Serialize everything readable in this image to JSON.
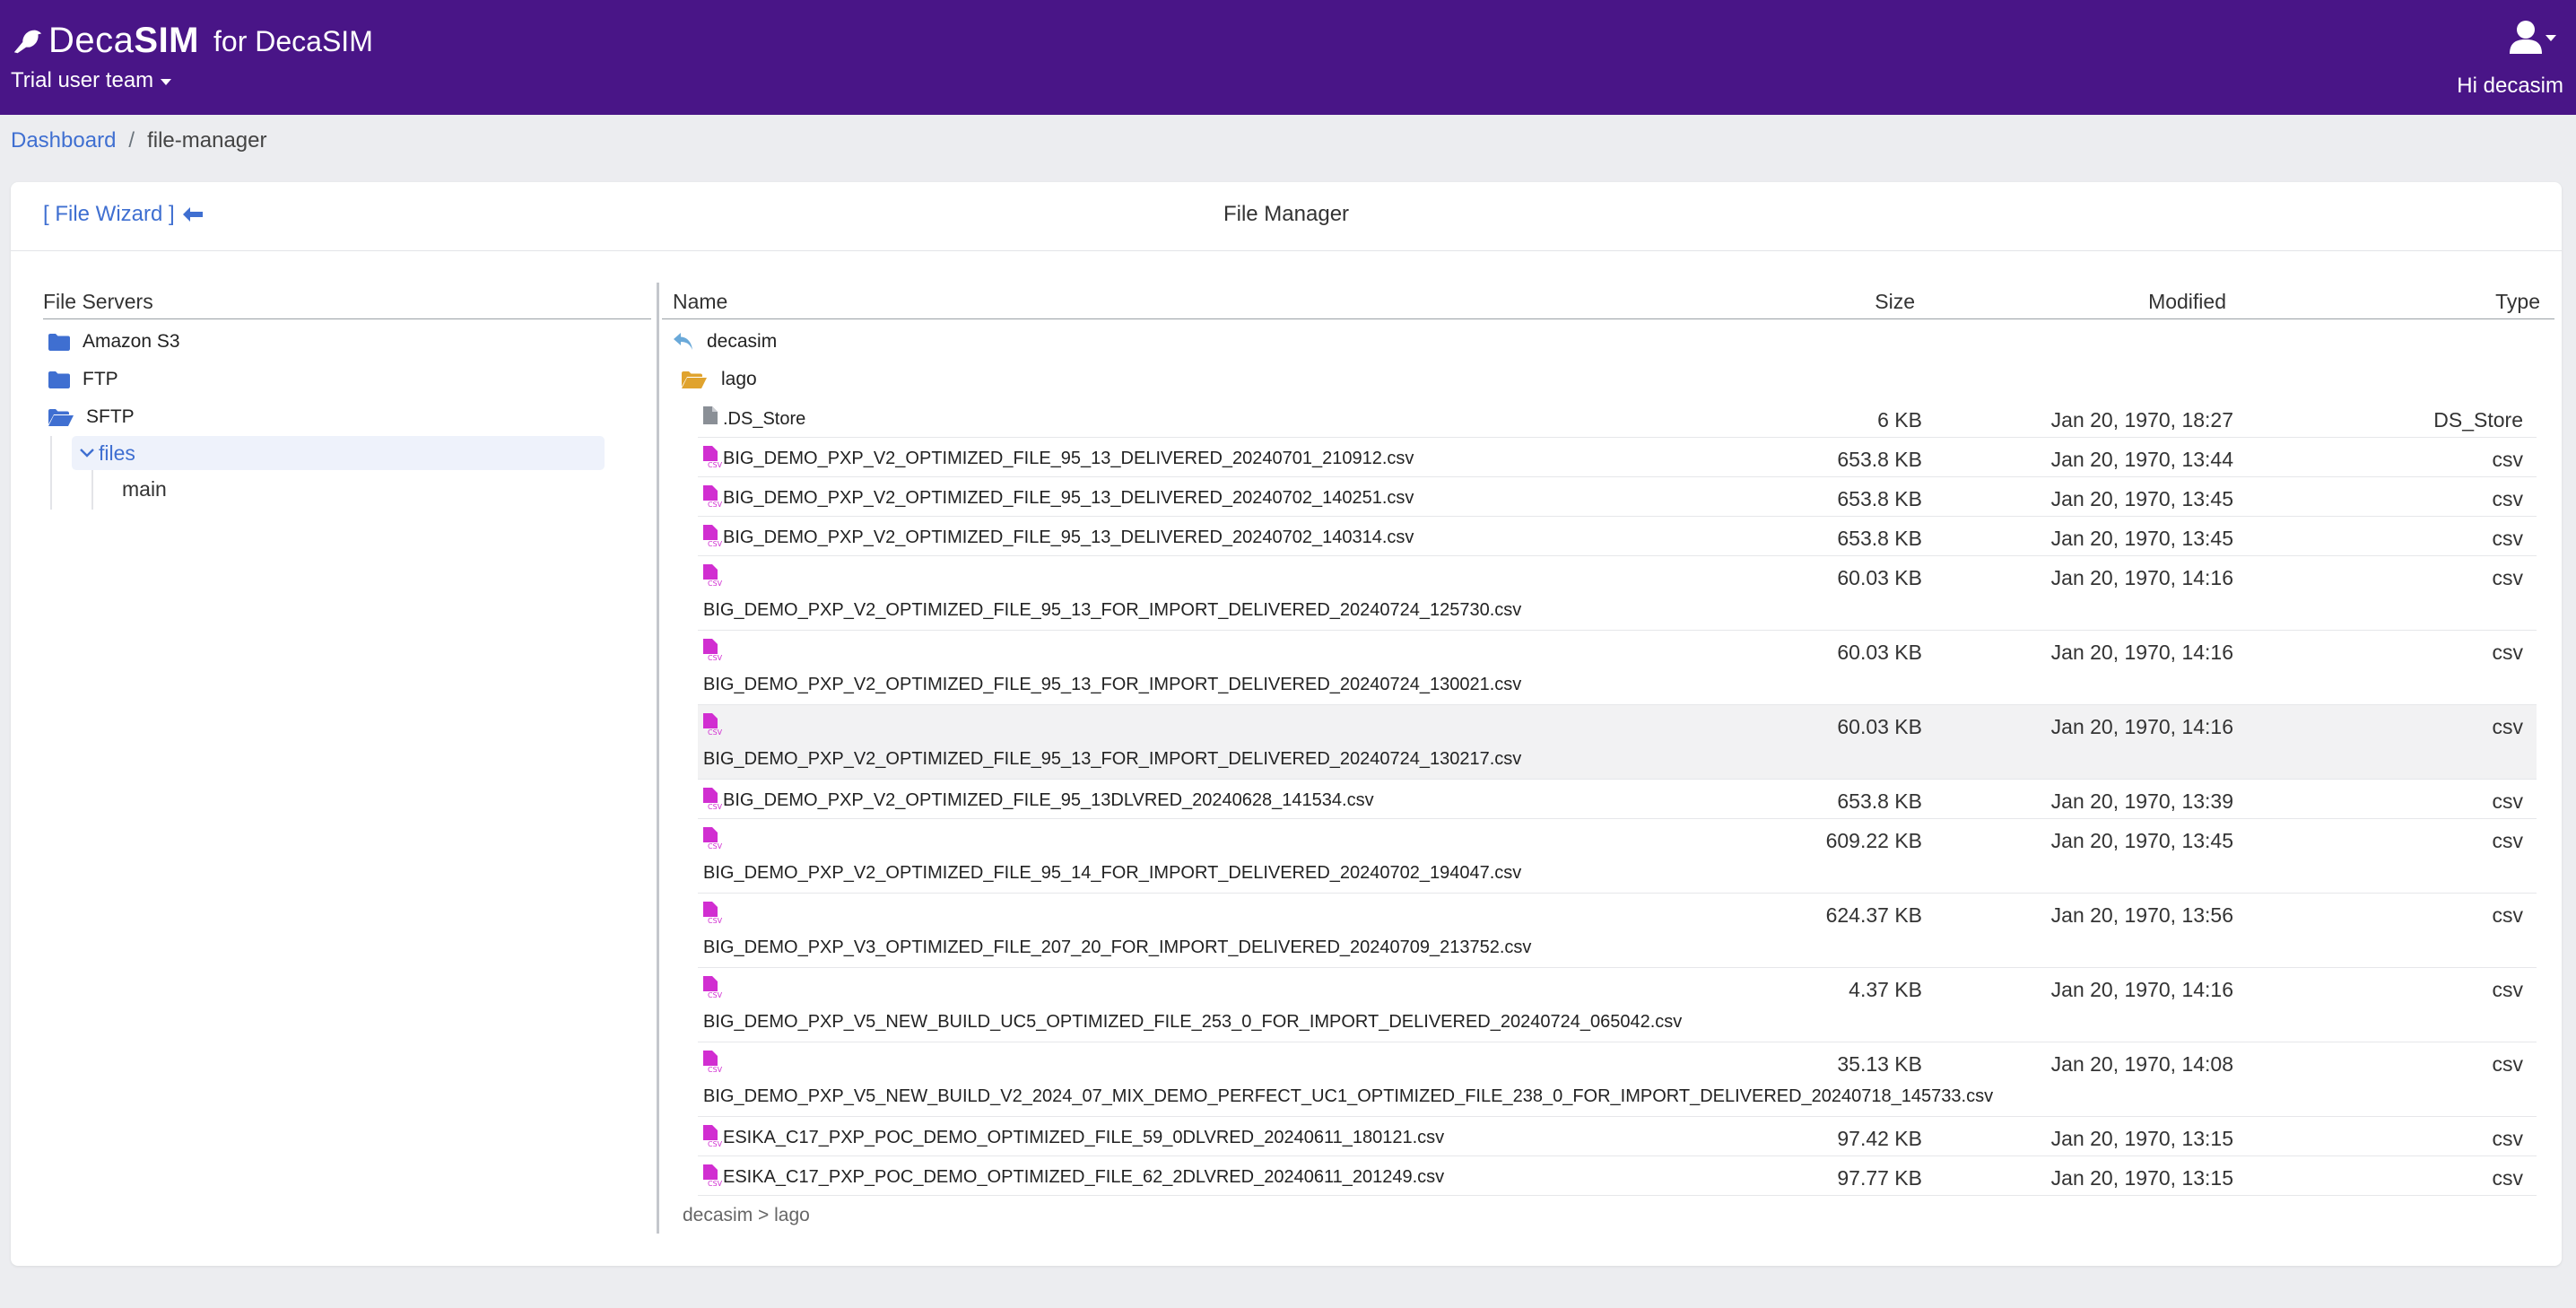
{
  "brand": {
    "deca": "Deca",
    "sim": "SIM",
    "suffix": "for DecaSIM"
  },
  "navbar": {
    "team": "Trial user team",
    "greeting": "Hi decasim",
    "user_icon": "user-icon"
  },
  "breadcrumb": {
    "home": "Dashboard",
    "separator": "/",
    "current": "file-manager"
  },
  "card": {
    "wizard_label": "[ File Wizard ]",
    "title": "File Manager"
  },
  "servers": {
    "header": "File Servers",
    "items": [
      {
        "label": "Amazon S3",
        "icon": "folder-icon"
      },
      {
        "label": "FTP",
        "icon": "folder-icon"
      },
      {
        "label": "SFTP",
        "icon": "folder-open-icon"
      }
    ],
    "files_node": "files",
    "main_node": "main"
  },
  "list": {
    "columns": {
      "name": "Name",
      "size": "Size",
      "modified": "Modified",
      "type": "Type"
    },
    "up_label": "decasim",
    "folder_label": "lago",
    "rows": [
      {
        "name": ".DS_Store",
        "size": "6 KB",
        "modified": "Jan 20, 1970, 18:27",
        "type": "DS_Store"
      },
      {
        "name": "BIG_DEMO_PXP_V2_OPTIMIZED_FILE_95_13_DELIVERED_20240701_210912.csv",
        "size": "653.8 KB",
        "modified": "Jan 20, 1970, 13:44",
        "type": "csv"
      },
      {
        "name": "BIG_DEMO_PXP_V2_OPTIMIZED_FILE_95_13_DELIVERED_20240702_140251.csv",
        "size": "653.8 KB",
        "modified": "Jan 20, 1970, 13:45",
        "type": "csv"
      },
      {
        "name": "BIG_DEMO_PXP_V2_OPTIMIZED_FILE_95_13_DELIVERED_20240702_140314.csv",
        "size": "653.8 KB",
        "modified": "Jan 20, 1970, 13:45",
        "type": "csv"
      },
      {
        "name": "BIG_DEMO_PXP_V2_OPTIMIZED_FILE_95_13_FOR_IMPORT_DELIVERED_20240724_125730.csv",
        "size": "60.03 KB",
        "modified": "Jan 20, 1970, 14:16",
        "type": "csv"
      },
      {
        "name": "BIG_DEMO_PXP_V2_OPTIMIZED_FILE_95_13_FOR_IMPORT_DELIVERED_20240724_130021.csv",
        "size": "60.03 KB",
        "modified": "Jan 20, 1970, 14:16",
        "type": "csv"
      },
      {
        "name": "BIG_DEMO_PXP_V2_OPTIMIZED_FILE_95_13_FOR_IMPORT_DELIVERED_20240724_130217.csv",
        "size": "60.03 KB",
        "modified": "Jan 20, 1970, 14:16",
        "type": "csv"
      },
      {
        "name": "BIG_DEMO_PXP_V2_OPTIMIZED_FILE_95_13DLVRED_20240628_141534.csv",
        "size": "653.8 KB",
        "modified": "Jan 20, 1970, 13:39",
        "type": "csv"
      },
      {
        "name": "BIG_DEMO_PXP_V2_OPTIMIZED_FILE_95_14_FOR_IMPORT_DELIVERED_20240702_194047.csv",
        "size": "609.22 KB",
        "modified": "Jan 20, 1970, 13:45",
        "type": "csv"
      },
      {
        "name": "BIG_DEMO_PXP_V3_OPTIMIZED_FILE_207_20_FOR_IMPORT_DELIVERED_20240709_213752.csv",
        "size": "624.37 KB",
        "modified": "Jan 20, 1970, 13:56",
        "type": "csv"
      },
      {
        "name": "BIG_DEMO_PXP_V5_NEW_BUILD_UC5_OPTIMIZED_FILE_253_0_FOR_IMPORT_DELIVERED_20240724_065042.csv",
        "size": "4.37 KB",
        "modified": "Jan 20, 1970, 14:16",
        "type": "csv"
      },
      {
        "name": "BIG_DEMO_PXP_V5_NEW_BUILD_V2_2024_07_MIX_DEMO_PERFECT_UC1_OPTIMIZED_FILE_238_0_FOR_IMPORT_DELIVERED_20240718_145733.csv",
        "size": "35.13 KB",
        "modified": "Jan 20, 1970, 14:08",
        "type": "csv"
      },
      {
        "name": "ESIKA_C17_PXP_POC_DEMO_OPTIMIZED_FILE_59_0DLVRED_20240611_180121.csv",
        "size": "97.42 KB",
        "modified": "Jan 20, 1970, 13:15",
        "type": "csv"
      },
      {
        "name": "ESIKA_C17_PXP_POC_DEMO_OPTIMIZED_FILE_62_2DLVRED_20240611_201249.csv",
        "size": "97.77 KB",
        "modified": "Jan 20, 1970, 13:15",
        "type": "csv"
      }
    ]
  },
  "status_path": "decasim > lago",
  "colors": {
    "navbar": "#491587",
    "link": "#3f6fd1",
    "csv_icon": "#d12ed1",
    "folder": "#3f6fd1",
    "folder_open": "#e0a32e"
  }
}
